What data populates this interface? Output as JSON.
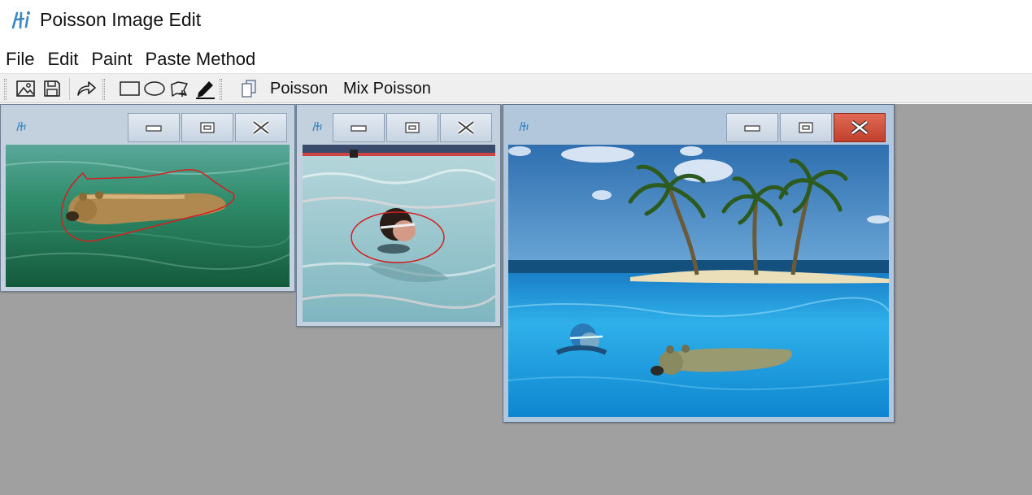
{
  "app": {
    "title": "Poisson Image Edit",
    "icon": "app-logo-icon"
  },
  "menu": {
    "items": [
      {
        "id": "file",
        "label": "File"
      },
      {
        "id": "edit",
        "label": "Edit"
      },
      {
        "id": "paint",
        "label": "Paint"
      },
      {
        "id": "paste-method",
        "label": "Paste Method"
      }
    ]
  },
  "toolbar": {
    "icons": [
      "open-image-icon",
      "save-icon",
      "redo-icon",
      "rectangle-tool-icon",
      "ellipse-tool-icon",
      "polygon-tool-icon",
      "pen-tool-icon",
      "paste-icon"
    ],
    "poisson_label": "Poisson",
    "mix_poisson_label": "Mix Poisson"
  },
  "windows": [
    {
      "id": "bear-source",
      "content": "bear swimming in green water with red freehand selection outline",
      "state": "inactive"
    },
    {
      "id": "swimmer-source",
      "content": "swimmer in pool with red elliptical selection",
      "state": "inactive"
    },
    {
      "id": "result",
      "content": "tropical island with palm trees, swimmer and bear pasted into blue sea",
      "state": "active"
    }
  ],
  "colors": {
    "workspace": "#a0a0a0",
    "toolbar": "#efefef",
    "selection_outline": "#d42020",
    "close_active": "#c74a36"
  }
}
